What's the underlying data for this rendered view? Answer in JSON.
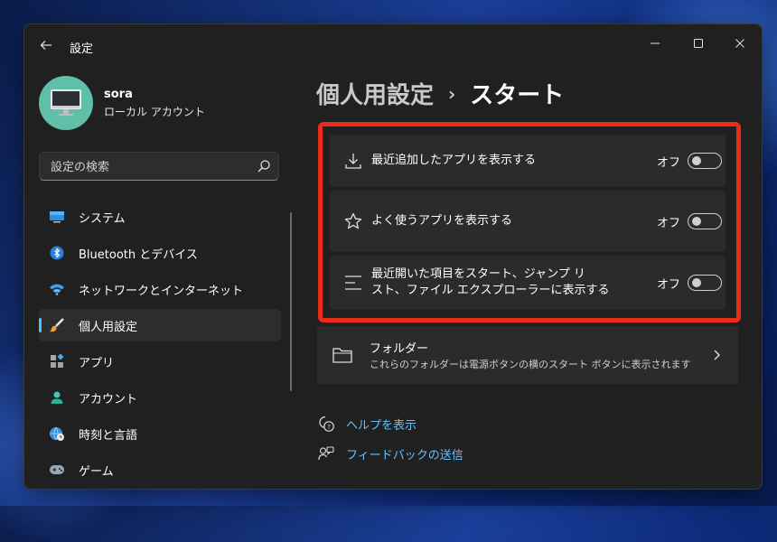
{
  "window": {
    "title": "設定"
  },
  "profile": {
    "name": "sora",
    "account_type": "ローカル アカウント"
  },
  "search": {
    "placeholder": "設定の検索"
  },
  "sidebar": {
    "items": [
      {
        "label": "システム",
        "icon": "display-icon"
      },
      {
        "label": "Bluetooth とデバイス",
        "icon": "bluetooth-icon"
      },
      {
        "label": "ネットワークとインターネット",
        "icon": "wifi-icon"
      },
      {
        "label": "個人用設定",
        "icon": "brush-icon",
        "active": true
      },
      {
        "label": "アプリ",
        "icon": "apps-icon"
      },
      {
        "label": "アカウント",
        "icon": "person-icon"
      },
      {
        "label": "時刻と言語",
        "icon": "globe-clock-icon"
      },
      {
        "label": "ゲーム",
        "icon": "gamepad-icon"
      }
    ]
  },
  "breadcrumb": {
    "parent": "個人用設定",
    "separator": "›",
    "current": "スタート"
  },
  "settings": [
    {
      "label": "最近追加したアプリを表示する",
      "state": "オフ",
      "icon": "download-icon",
      "on": false
    },
    {
      "label": "よく使うアプリを表示する",
      "state": "オフ",
      "icon": "star-icon",
      "on": false
    },
    {
      "label_line1": "最近開いた項目をスタート、ジャンプ リ",
      "label_line2": "スト、ファイル エクスプローラーに表示する",
      "state": "オフ",
      "icon": "list-icon",
      "on": false
    }
  ],
  "folders": {
    "title": "フォルダー",
    "description": "これらのフォルダーは電源ボタンの横のスタート ボタンに表示されます"
  },
  "links": {
    "help": "ヘルプを表示",
    "feedback": "フィードバックの送信"
  },
  "colors": {
    "accent": "#4cc2ff",
    "highlight_border": "#ee2a1a",
    "window_bg": "#202020",
    "card_bg": "#2b2b2b",
    "link": "#62c1ff"
  }
}
